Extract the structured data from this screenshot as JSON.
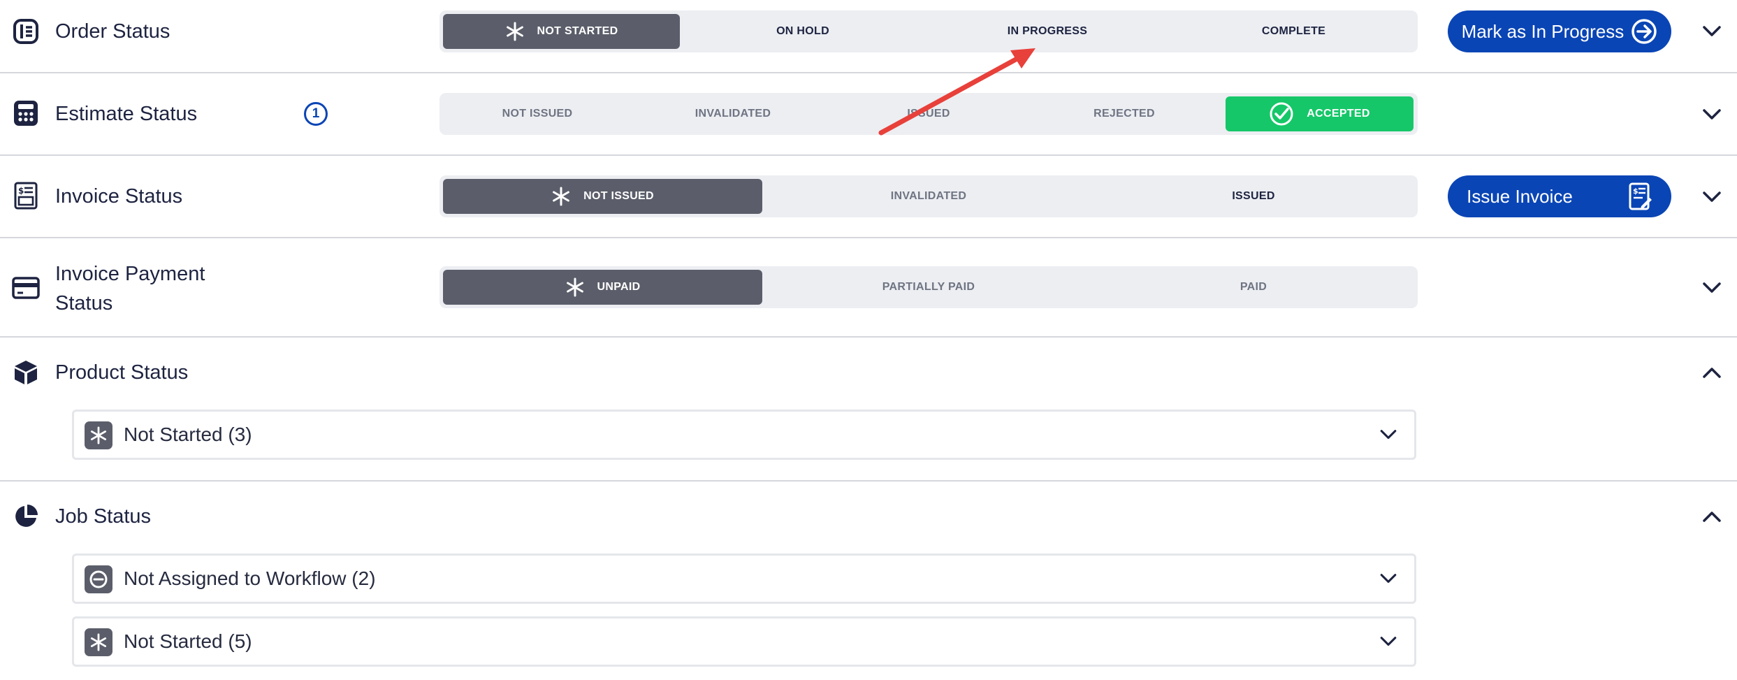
{
  "sections": {
    "order": {
      "title": "Order Status",
      "icon": "order-list-icon",
      "options": [
        "NOT STARTED",
        "ON HOLD",
        "IN PROGRESS",
        "COMPLETE"
      ],
      "selected": "NOT STARTED",
      "action_label": "Mark as In Progress",
      "action_icon": "arrow-right-circle-icon"
    },
    "estimate": {
      "title": "Estimate Status",
      "icon": "calculator-icon",
      "badge": "1",
      "options": [
        "NOT ISSUED",
        "INVALIDATED",
        "ISSUED",
        "REJECTED",
        "ACCEPTED"
      ],
      "selected": "ACCEPTED"
    },
    "invoice": {
      "title": "Invoice Status",
      "icon": "invoice-icon",
      "options": [
        "NOT ISSUED",
        "INVALIDATED",
        "ISSUED"
      ],
      "selected": "NOT ISSUED",
      "action_label": "Issue Invoice",
      "action_icon": "invoice-edit-icon"
    },
    "payment": {
      "title_line1": "Invoice Payment",
      "title_line2": "Status",
      "icon": "credit-card-icon",
      "options": [
        "UNPAID",
        "PARTIALLY PAID",
        "PAID"
      ],
      "selected": "UNPAID"
    },
    "product": {
      "title": "Product Status",
      "icon": "cube-icon",
      "groups": [
        {
          "label": "Not Started (3)",
          "icon": "asterisk-icon"
        }
      ]
    },
    "job": {
      "title": "Job Status",
      "icon": "pie-chart-icon",
      "groups": [
        {
          "label": "Not Assigned to Workflow (2)",
          "icon": "minus-circle-icon"
        },
        {
          "label": "Not Started (5)",
          "icon": "asterisk-icon"
        }
      ]
    }
  },
  "colors": {
    "primary": "#0a45b5",
    "active_segment": "#5b5e6a",
    "accepted": "#15c768",
    "annotation_arrow": "#e8403a",
    "segment_bg": "#eceef2"
  }
}
